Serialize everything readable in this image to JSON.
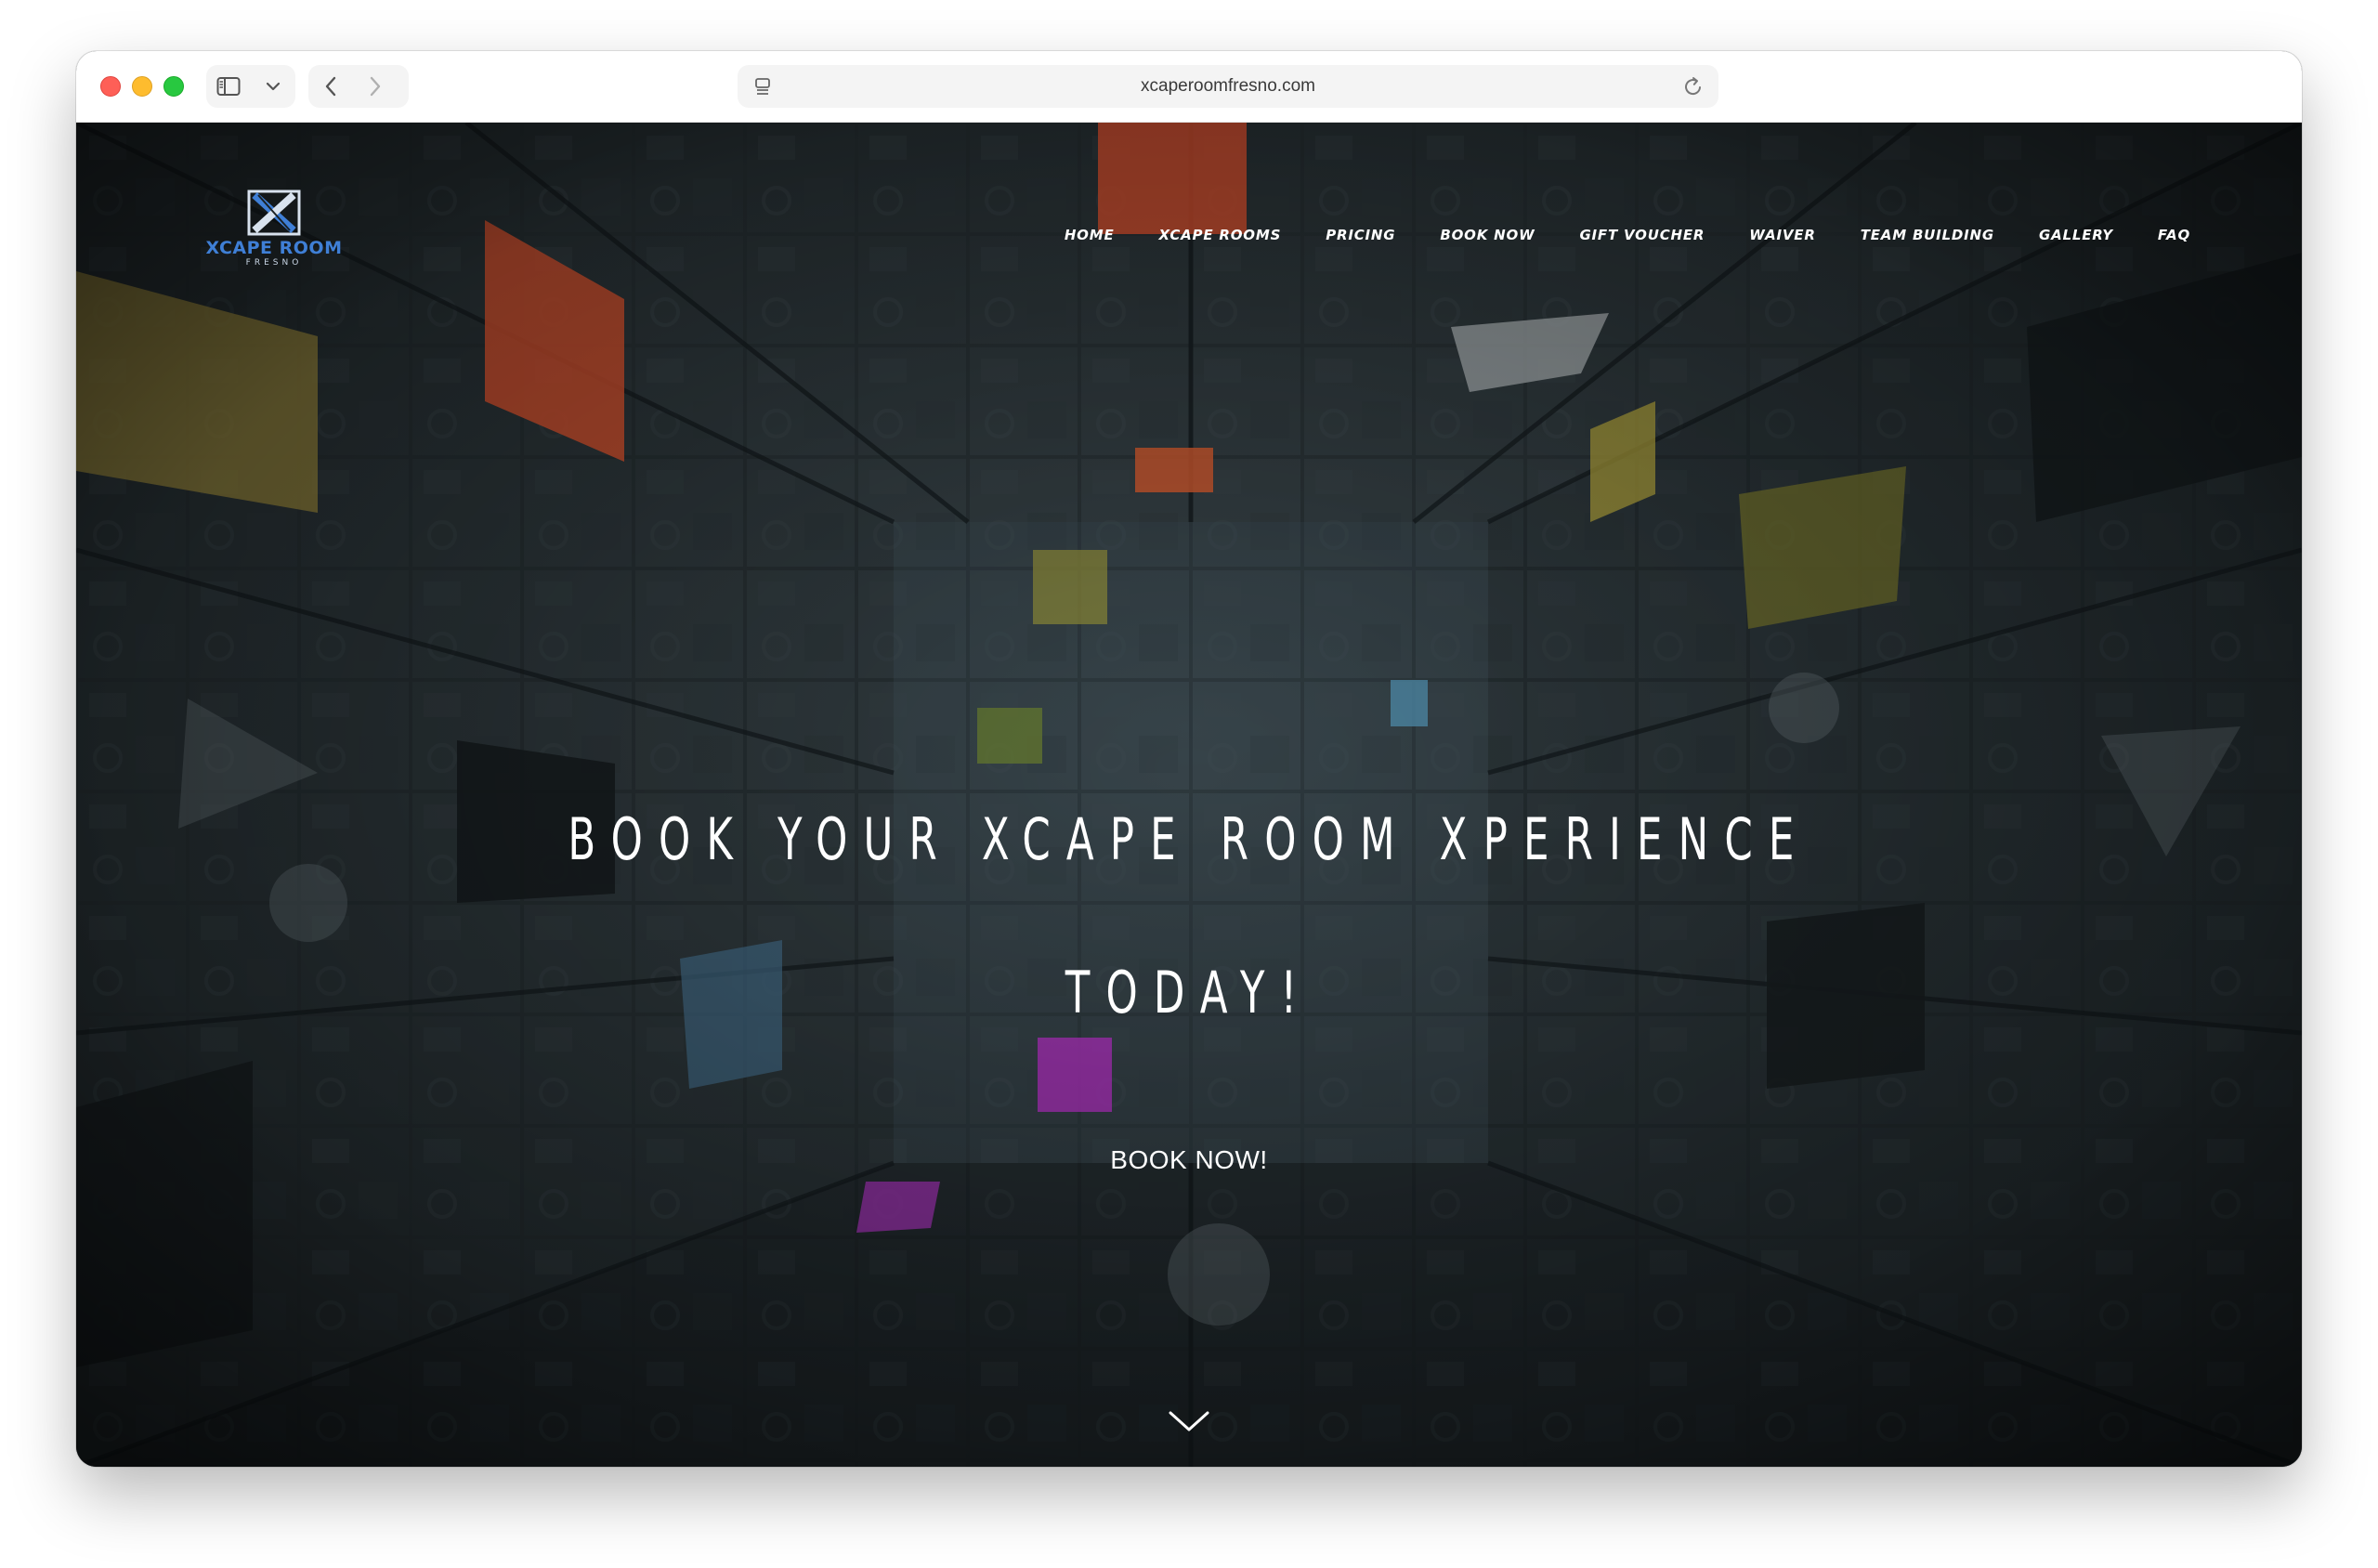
{
  "browser": {
    "url": "xcaperoomfresno.com"
  },
  "site": {
    "logo_name": "XCAPE ROOM",
    "logo_sub": "FRESNO",
    "nav": [
      {
        "label": "HOME"
      },
      {
        "label": "XCAPE ROOMS"
      },
      {
        "label": "PRICING"
      },
      {
        "label": "BOOK NOW"
      },
      {
        "label": "GIFT VOUCHER"
      },
      {
        "label": "WAIVER"
      },
      {
        "label": "TEAM BUILDING"
      },
      {
        "label": "GALLERY"
      },
      {
        "label": "FAQ"
      }
    ]
  },
  "hero": {
    "title_line1": "BOOK YOUR XCAPE ROOM XPERIENCE",
    "title_line2": "TODAY!",
    "cta": "BOOK NOW!",
    "scroll_icon": "chevron-down-icon"
  },
  "colors": {
    "brand_blue": "#3f7fd6",
    "text": "#ffffff"
  }
}
